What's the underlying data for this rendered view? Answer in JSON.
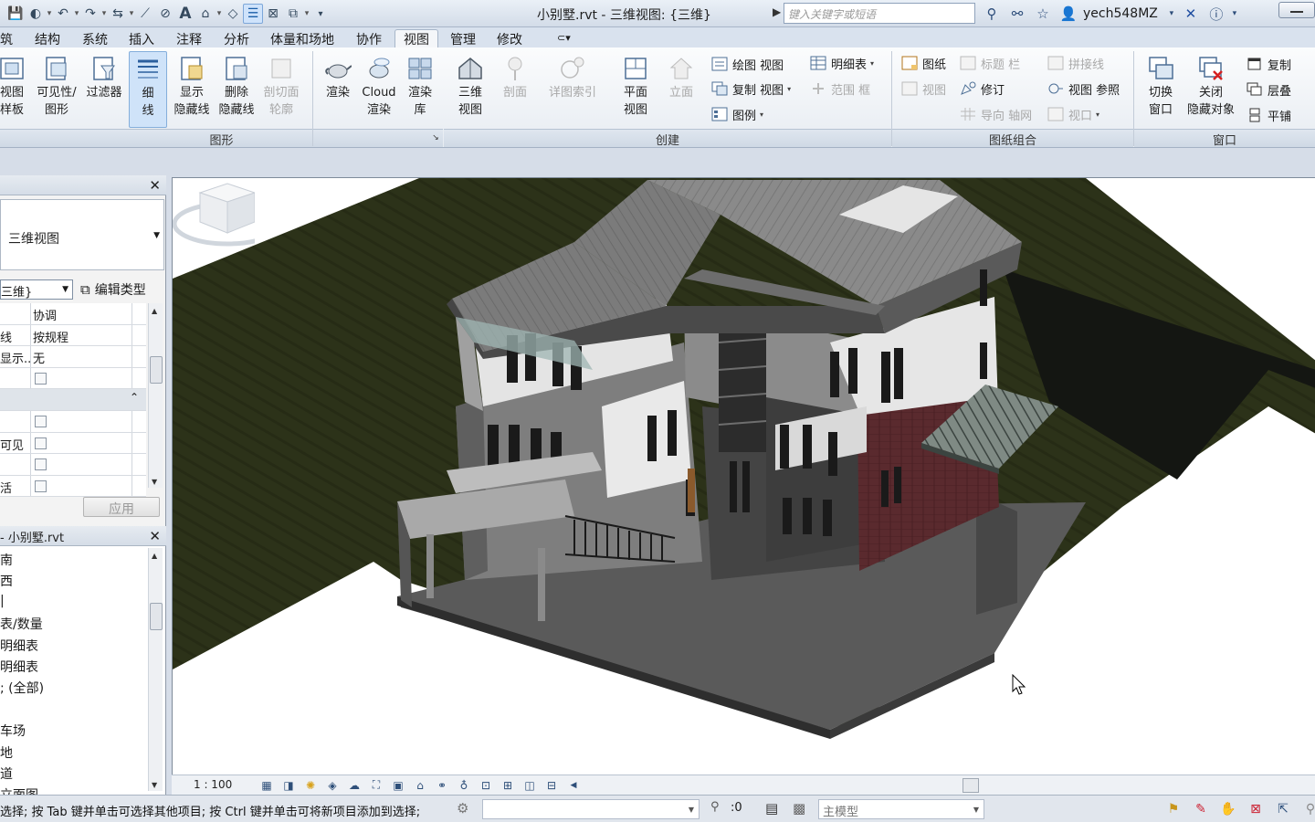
{
  "titlebar": {
    "title": "小别墅.rvt - 三维视图: {三维}",
    "search_placeholder": "键入关键字或短语",
    "user": "yech548MZ"
  },
  "tabs": [
    "筑",
    "结构",
    "系统",
    "插入",
    "注释",
    "分析",
    "体量和场地",
    "协作",
    "视图",
    "管理",
    "修改"
  ],
  "ribbon": {
    "graphics_panel": {
      "title": "图形",
      "buttons": [
        "视图\n样板",
        "可见性/\n图形",
        "过滤器",
        "细\n线",
        "显示\n隐藏线",
        "删除\n隐藏线",
        "剖切面\n轮廓"
      ]
    },
    "create_panel": {
      "title": "创建",
      "buttons": [
        "渲染",
        "Cloud\n渲染",
        "渲染\n库",
        "三维\n视图",
        "剖面",
        "详图索引",
        "平面\n视图",
        "立面"
      ],
      "small": [
        "绘图 视图",
        "复制 视图",
        "图例",
        "明细表",
        "范围 框"
      ]
    },
    "sheet_panel": {
      "title": "图纸组合",
      "small": [
        "图纸",
        "标题 栏",
        "拼接线",
        "视图",
        "修订",
        "视图 参照",
        "导向 轴网",
        "视口"
      ]
    },
    "window_panel": {
      "title": "窗口",
      "buttons": [
        "切换\n窗口",
        "关闭\n隐藏对象"
      ],
      "small": [
        "复制",
        "层叠",
        "平铺"
      ]
    }
  },
  "properties": {
    "type_name": "三维视图",
    "instance": "三维}",
    "edit_type": "编辑类型",
    "rows": [
      {
        "key": "",
        "value": "协调",
        "kind": "text"
      },
      {
        "key": "线",
        "value": "按规程",
        "kind": "text"
      },
      {
        "key": "显示...",
        "value": "无",
        "kind": "text"
      },
      {
        "key": "",
        "value": "",
        "kind": "check"
      },
      {
        "key": "",
        "value": "",
        "kind": "group"
      },
      {
        "key": "",
        "value": "",
        "kind": "check"
      },
      {
        "key": "可见",
        "value": "",
        "kind": "check"
      },
      {
        "key": "",
        "value": "",
        "kind": "check"
      },
      {
        "key": "活",
        "value": "",
        "kind": "check"
      }
    ],
    "apply_label": "应用"
  },
  "browser": {
    "title": "- 小别墅.rvt",
    "items": [
      "南",
      "西",
      "|",
      "表/数量",
      "明细表",
      "明细表",
      "; (全部)",
      "",
      "车场",
      "地",
      "道",
      "立面图"
    ]
  },
  "viewbar": {
    "scale": "1 : 100"
  },
  "status": {
    "text": "选择; 按 Tab 键并单击可选择其他项目; 按 Ctrl 键并单击可将新项目添加到选择;",
    "select_count": ":0",
    "model": "主模型"
  },
  "colors": {
    "ribbon_bg": "#eef2f6",
    "selected_btn": "#cfe3f9",
    "terrain": "#2c3219",
    "roof": "#7b7b7b",
    "wall_light": "#e6e6e6",
    "brick": "#5a2a2e"
  }
}
